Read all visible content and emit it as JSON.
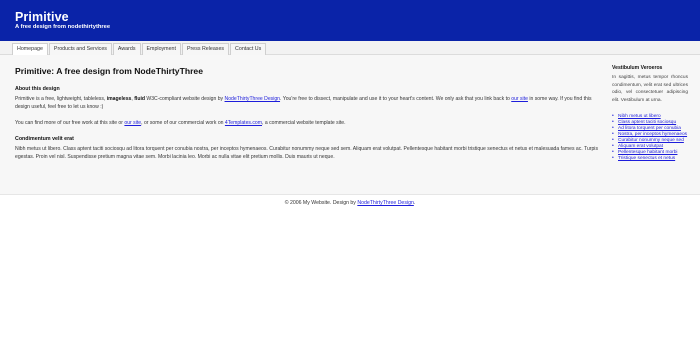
{
  "header": {
    "title": "Primitive",
    "tagline": "A free design from nodethirtythree"
  },
  "nav": {
    "tabs": [
      {
        "label": "Homepage",
        "active": true
      },
      {
        "label": "Products and Services",
        "active": false
      },
      {
        "label": "Awards",
        "active": false
      },
      {
        "label": "Employment",
        "active": false
      },
      {
        "label": "Press Releases",
        "active": false
      },
      {
        "label": "Contact Us",
        "active": false
      }
    ]
  },
  "main": {
    "title": "Primitive: A free design from NodeThirtyThree",
    "about_heading": "About this design",
    "about_p1": {
      "t1": "Primitive is a free, lightweight, tableless, ",
      "b1": "imageless",
      "t2": ", ",
      "b2": "fluid",
      "t3": " W3C-compliant website design by ",
      "link1": "NodeThirtyThree Design",
      "t4": ". You're free to dissect, manipulate and use it to your heart's content. We only ask that you link back to ",
      "link2": "our site",
      "t5": " in some way. If you find this design useful, feel free to let us know :)"
    },
    "about_p2": {
      "t1": "You can find more of our free work at this site or ",
      "link1": "our site",
      "t2": ", or some of our commercial work on ",
      "link2": "4Templates.com",
      "t3": ", a commercial website template site."
    },
    "condimentum_heading": "Condimentum velit erat",
    "condimentum_p": "Nibh metus ut libero. Class aptent taciti sociosqu ad litora torquent per conubia nostra, per inceptos hymenaeos. Curabitur nonummy neque sed sem. Aliquam erat volutpat. Pellentesque habitant morbi tristique senectus et netus et malesuada fames ac. Turpis egestas. Proin vel nisl. Suspendisse pretium magna vitae sem. Morbi lacinia leo. Morbi ac nulla vitae elit pretium mollis. Duis mauris ut neque."
  },
  "sidebar": {
    "heading": "Vestibulum Veroeros",
    "text": "In sagittis, metus tempor rhoncus condimentum, velit erat sed ultrices odio, vel consectetuer adipiscing elit. Vestibulum at urna.",
    "links": [
      "Nibh metus ut libero",
      "Class aptent taciti sociosqu",
      "Ad litora torquent per conubia",
      "Nostra, per inceptos hymenaeos",
      "Curabitur nonummy neque sed",
      "Aliquam erat volutpat",
      "Pellentesque habitant morbi",
      "Tristique senectus et netus"
    ]
  },
  "footer": {
    "text": "© 2006 My Website. Design by ",
    "link": "NodeThirtyThree Design",
    "end": "."
  }
}
